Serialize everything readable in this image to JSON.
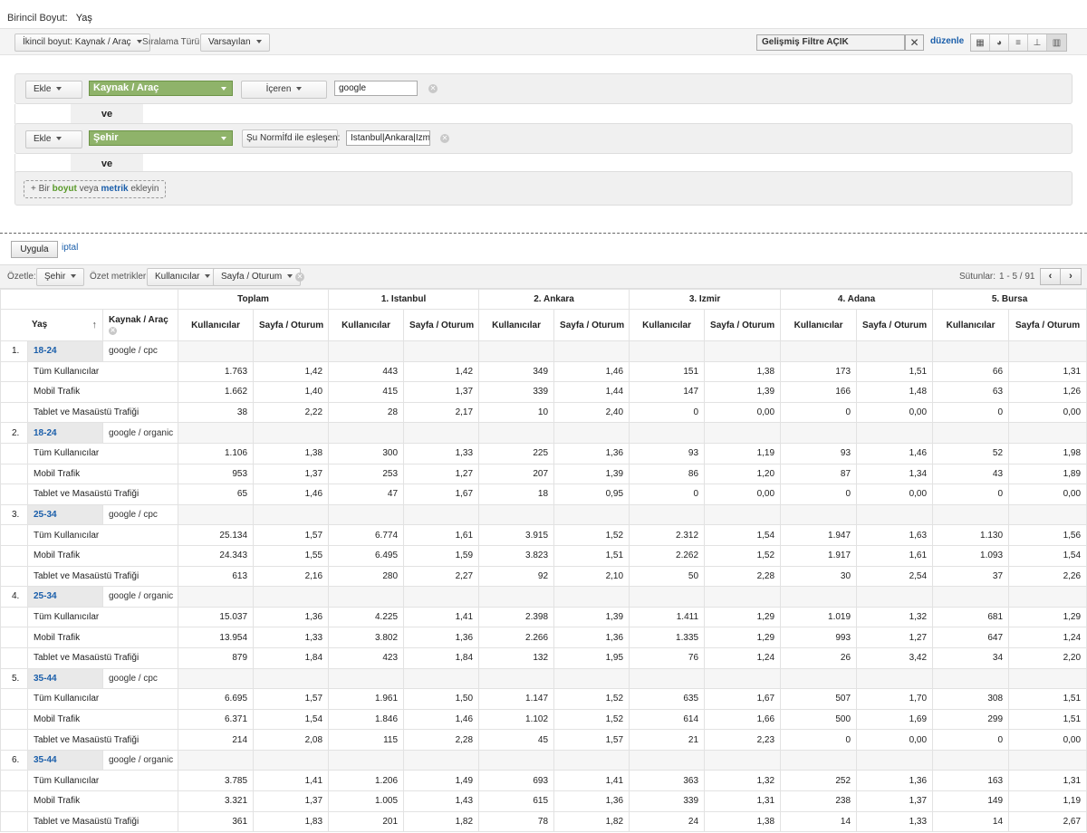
{
  "primary_dimension": {
    "label": "Birincil Boyut:",
    "value": "Yaş"
  },
  "toolbar": {
    "secondary_dim": "İkincil boyut: Kaynak / Araç",
    "sort_label": "Sıralama Türü:",
    "sort_value": "Varsayılan",
    "advanced_filter": "Gelişmiş Filtre AÇIK",
    "edit": "düzenle"
  },
  "filter": {
    "add": "Ekle",
    "and": "ve",
    "row1": {
      "dimension": "Kaynak / Araç",
      "match": "İçeren",
      "value": "google"
    },
    "row2": {
      "dimension": "Şehir",
      "match": "Şu Normİfd ile eşleşen:",
      "value": "Istanbul|Ankara|Izmir"
    },
    "add_dim": {
      "prefix": "+ Bir ",
      "dim": "boyut",
      "mid": " veya ",
      "metric": "metrik",
      "suffix": " ekleyin"
    }
  },
  "actions": {
    "apply": "Uygula",
    "cancel": "iptal"
  },
  "summary": {
    "label": "Özetle:",
    "dimension": "Şehir",
    "metrics_label": "Özet metrikler:",
    "metric1": "Kullanıcılar",
    "metric2": "Sayfa / Oturum",
    "columns": "Sütunlar:",
    "range": "1 - 5 / 91"
  },
  "table": {
    "groups": [
      "Toplam",
      "1. Istanbul",
      "2. Ankara",
      "3. Izmir",
      "4. Adana",
      "5. Bursa"
    ],
    "age_header": "Yaş",
    "source_header": "Kaynak / Araç",
    "metric_users": "Kullanıcılar",
    "metric_pps": "Sayfa / Oturum",
    "rows": [
      {
        "idx": "1.",
        "age": "18-24",
        "source": "google / cpc",
        "segments": [
          {
            "name": "Tüm Kullanıcılar",
            "v": [
              "1.763",
              "1,42",
              "443",
              "1,42",
              "349",
              "1,46",
              "151",
              "1,38",
              "173",
              "1,51",
              "66",
              "1,31"
            ]
          },
          {
            "name": "Mobil Trafik",
            "v": [
              "1.662",
              "1,40",
              "415",
              "1,37",
              "339",
              "1,44",
              "147",
              "1,39",
              "166",
              "1,48",
              "63",
              "1,26"
            ]
          },
          {
            "name": "Tablet ve Masaüstü Trafiği",
            "v": [
              "38",
              "2,22",
              "28",
              "2,17",
              "10",
              "2,40",
              "0",
              "0,00",
              "0",
              "0,00",
              "0",
              "0,00"
            ]
          }
        ]
      },
      {
        "idx": "2.",
        "age": "18-24",
        "source": "google / organic",
        "segments": [
          {
            "name": "Tüm Kullanıcılar",
            "v": [
              "1.106",
              "1,38",
              "300",
              "1,33",
              "225",
              "1,36",
              "93",
              "1,19",
              "93",
              "1,46",
              "52",
              "1,98"
            ]
          },
          {
            "name": "Mobil Trafik",
            "v": [
              "953",
              "1,37",
              "253",
              "1,27",
              "207",
              "1,39",
              "86",
              "1,20",
              "87",
              "1,34",
              "43",
              "1,89"
            ]
          },
          {
            "name": "Tablet ve Masaüstü Trafiği",
            "v": [
              "65",
              "1,46",
              "47",
              "1,67",
              "18",
              "0,95",
              "0",
              "0,00",
              "0",
              "0,00",
              "0",
              "0,00"
            ]
          }
        ]
      },
      {
        "idx": "3.",
        "age": "25-34",
        "source": "google / cpc",
        "segments": [
          {
            "name": "Tüm Kullanıcılar",
            "v": [
              "25.134",
              "1,57",
              "6.774",
              "1,61",
              "3.915",
              "1,52",
              "2.312",
              "1,54",
              "1.947",
              "1,63",
              "1.130",
              "1,56"
            ]
          },
          {
            "name": "Mobil Trafik",
            "v": [
              "24.343",
              "1,55",
              "6.495",
              "1,59",
              "3.823",
              "1,51",
              "2.262",
              "1,52",
              "1.917",
              "1,61",
              "1.093",
              "1,54"
            ]
          },
          {
            "name": "Tablet ve Masaüstü Trafiği",
            "v": [
              "613",
              "2,16",
              "280",
              "2,27",
              "92",
              "2,10",
              "50",
              "2,28",
              "30",
              "2,54",
              "37",
              "2,26"
            ]
          }
        ]
      },
      {
        "idx": "4.",
        "age": "25-34",
        "source": "google / organic",
        "segments": [
          {
            "name": "Tüm Kullanıcılar",
            "v": [
              "15.037",
              "1,36",
              "4.225",
              "1,41",
              "2.398",
              "1,39",
              "1.411",
              "1,29",
              "1.019",
              "1,32",
              "681",
              "1,29"
            ]
          },
          {
            "name": "Mobil Trafik",
            "v": [
              "13.954",
              "1,33",
              "3.802",
              "1,36",
              "2.266",
              "1,36",
              "1.335",
              "1,29",
              "993",
              "1,27",
              "647",
              "1,24"
            ]
          },
          {
            "name": "Tablet ve Masaüstü Trafiği",
            "v": [
              "879",
              "1,84",
              "423",
              "1,84",
              "132",
              "1,95",
              "76",
              "1,24",
              "26",
              "3,42",
              "34",
              "2,20"
            ]
          }
        ]
      },
      {
        "idx": "5.",
        "age": "35-44",
        "source": "google / cpc",
        "segments": [
          {
            "name": "Tüm Kullanıcılar",
            "v": [
              "6.695",
              "1,57",
              "1.961",
              "1,50",
              "1.147",
              "1,52",
              "635",
              "1,67",
              "507",
              "1,70",
              "308",
              "1,51"
            ]
          },
          {
            "name": "Mobil Trafik",
            "v": [
              "6.371",
              "1,54",
              "1.846",
              "1,46",
              "1.102",
              "1,52",
              "614",
              "1,66",
              "500",
              "1,69",
              "299",
              "1,51"
            ]
          },
          {
            "name": "Tablet ve Masaüstü Trafiği",
            "v": [
              "214",
              "2,08",
              "115",
              "2,28",
              "45",
              "1,57",
              "21",
              "2,23",
              "0",
              "0,00",
              "0",
              "0,00"
            ]
          }
        ]
      },
      {
        "idx": "6.",
        "age": "35-44",
        "source": "google / organic",
        "segments": [
          {
            "name": "Tüm Kullanıcılar",
            "v": [
              "3.785",
              "1,41",
              "1.206",
              "1,49",
              "693",
              "1,41",
              "363",
              "1,32",
              "252",
              "1,36",
              "163",
              "1,31"
            ]
          },
          {
            "name": "Mobil Trafik",
            "v": [
              "3.321",
              "1,37",
              "1.005",
              "1,43",
              "615",
              "1,36",
              "339",
              "1,31",
              "238",
              "1,37",
              "149",
              "1,19"
            ]
          },
          {
            "name": "Tablet ve Masaüstü Trafiği",
            "v": [
              "361",
              "1,83",
              "201",
              "1,82",
              "78",
              "1,82",
              "24",
              "1,38",
              "14",
              "1,33",
              "14",
              "2,67"
            ]
          }
        ]
      }
    ]
  }
}
